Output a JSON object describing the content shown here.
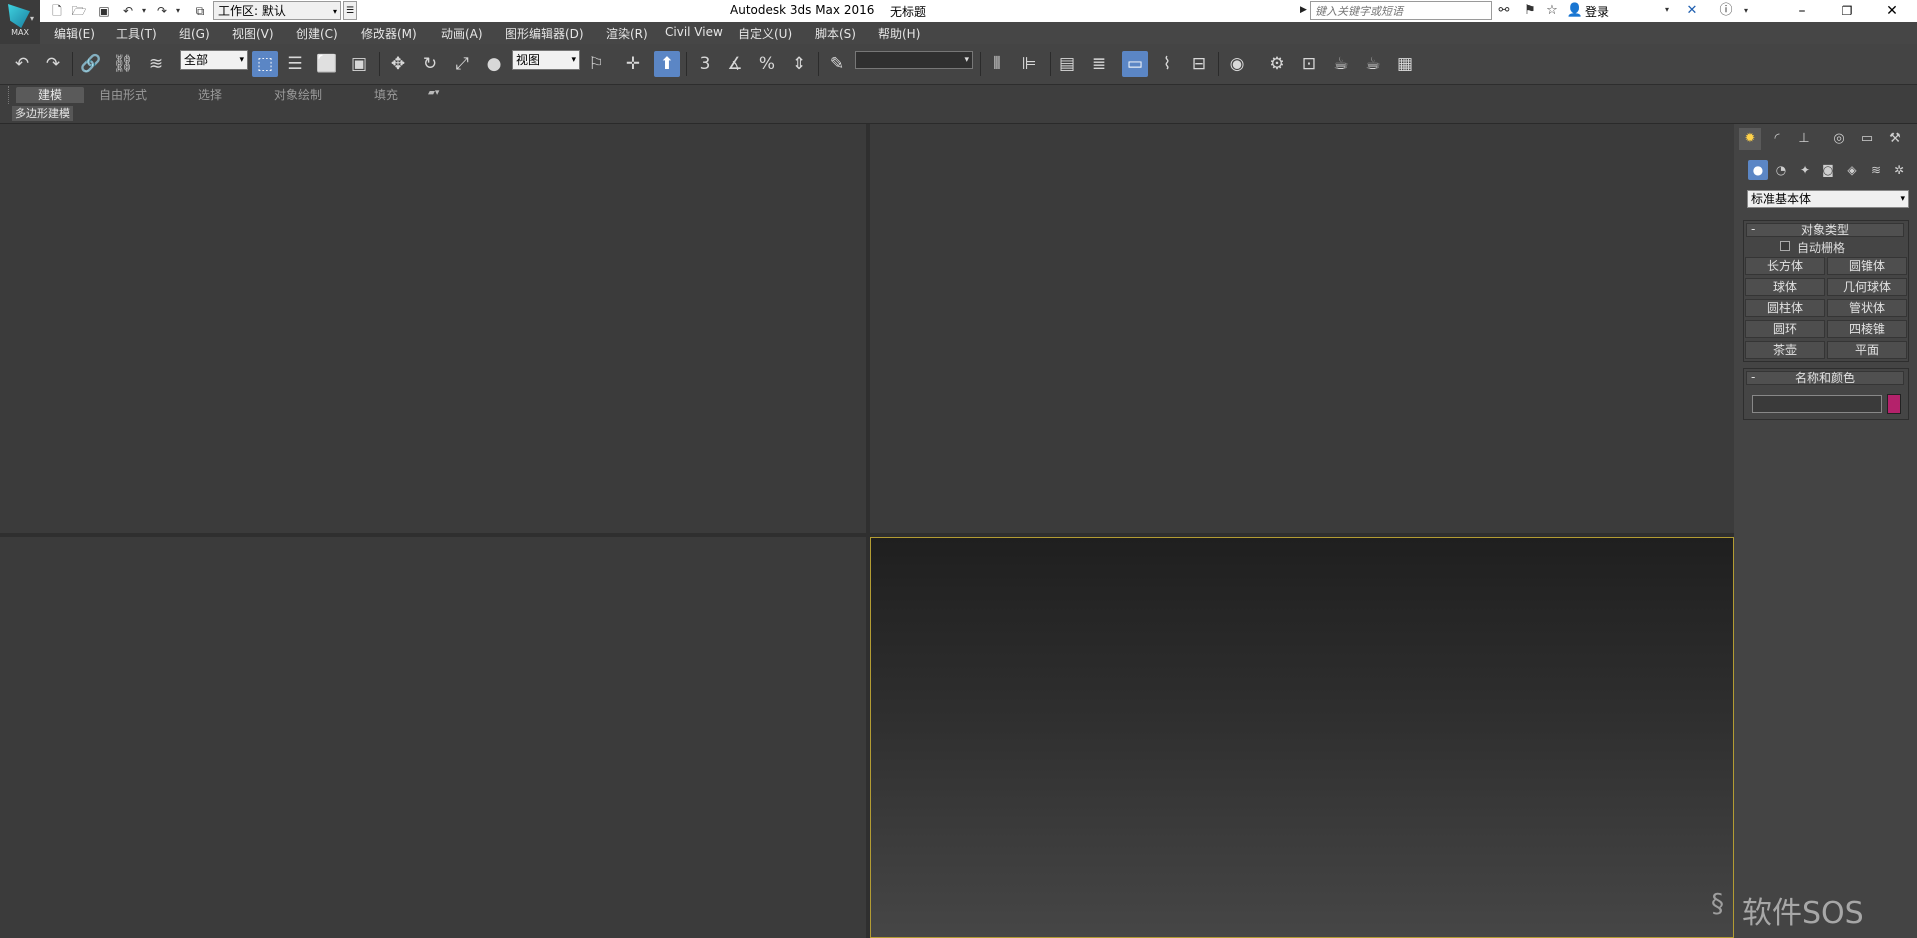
{
  "app": {
    "title": "Autodesk 3ds Max 2016",
    "document": "无标题",
    "logo_text": "MAX"
  },
  "quick_access": {
    "workspace": "工作区: 默认",
    "icons": [
      "new-file-icon",
      "open-file-icon",
      "save-icon",
      "undo-icon",
      "redo-icon",
      "project-folder-icon"
    ]
  },
  "infocenter": {
    "search_placeholder": "键入关键字或短语",
    "login": "登录"
  },
  "menu": [
    "编辑(E)",
    "工具(T)",
    "组(G)",
    "视图(V)",
    "创建(C)",
    "修改器(M)",
    "动画(A)",
    "图形编辑器(D)",
    "渲染(R)",
    "Civil View",
    "自定义(U)",
    "脚本(S)",
    "帮助(H)"
  ],
  "toolbar": {
    "selection_filter": "全部",
    "ref_coord": "视图",
    "snap_label": "3",
    "percent_label": "%"
  },
  "ribbon": {
    "tabs": [
      "建模",
      "自由形式",
      "选择",
      "对象绘制",
      "填充"
    ],
    "active_tab": "建模",
    "panel_label": "多边形建模"
  },
  "command_panel": {
    "category": "标准基本体",
    "object_type": {
      "title": "对象类型",
      "autogrid": "自动栅格",
      "buttons": [
        "长方体",
        "圆锥体",
        "球体",
        "几何球体",
        "圆柱体",
        "管状体",
        "圆环",
        "四棱锥",
        "茶壶",
        "平面"
      ]
    },
    "name_color": {
      "title": "名称和颜色",
      "name_value": "",
      "color": "#b4226b"
    }
  },
  "watermark": "软件SOS",
  "colors": {
    "active_viewport_border": "#b39c33",
    "active_button": "#5b86c5"
  }
}
